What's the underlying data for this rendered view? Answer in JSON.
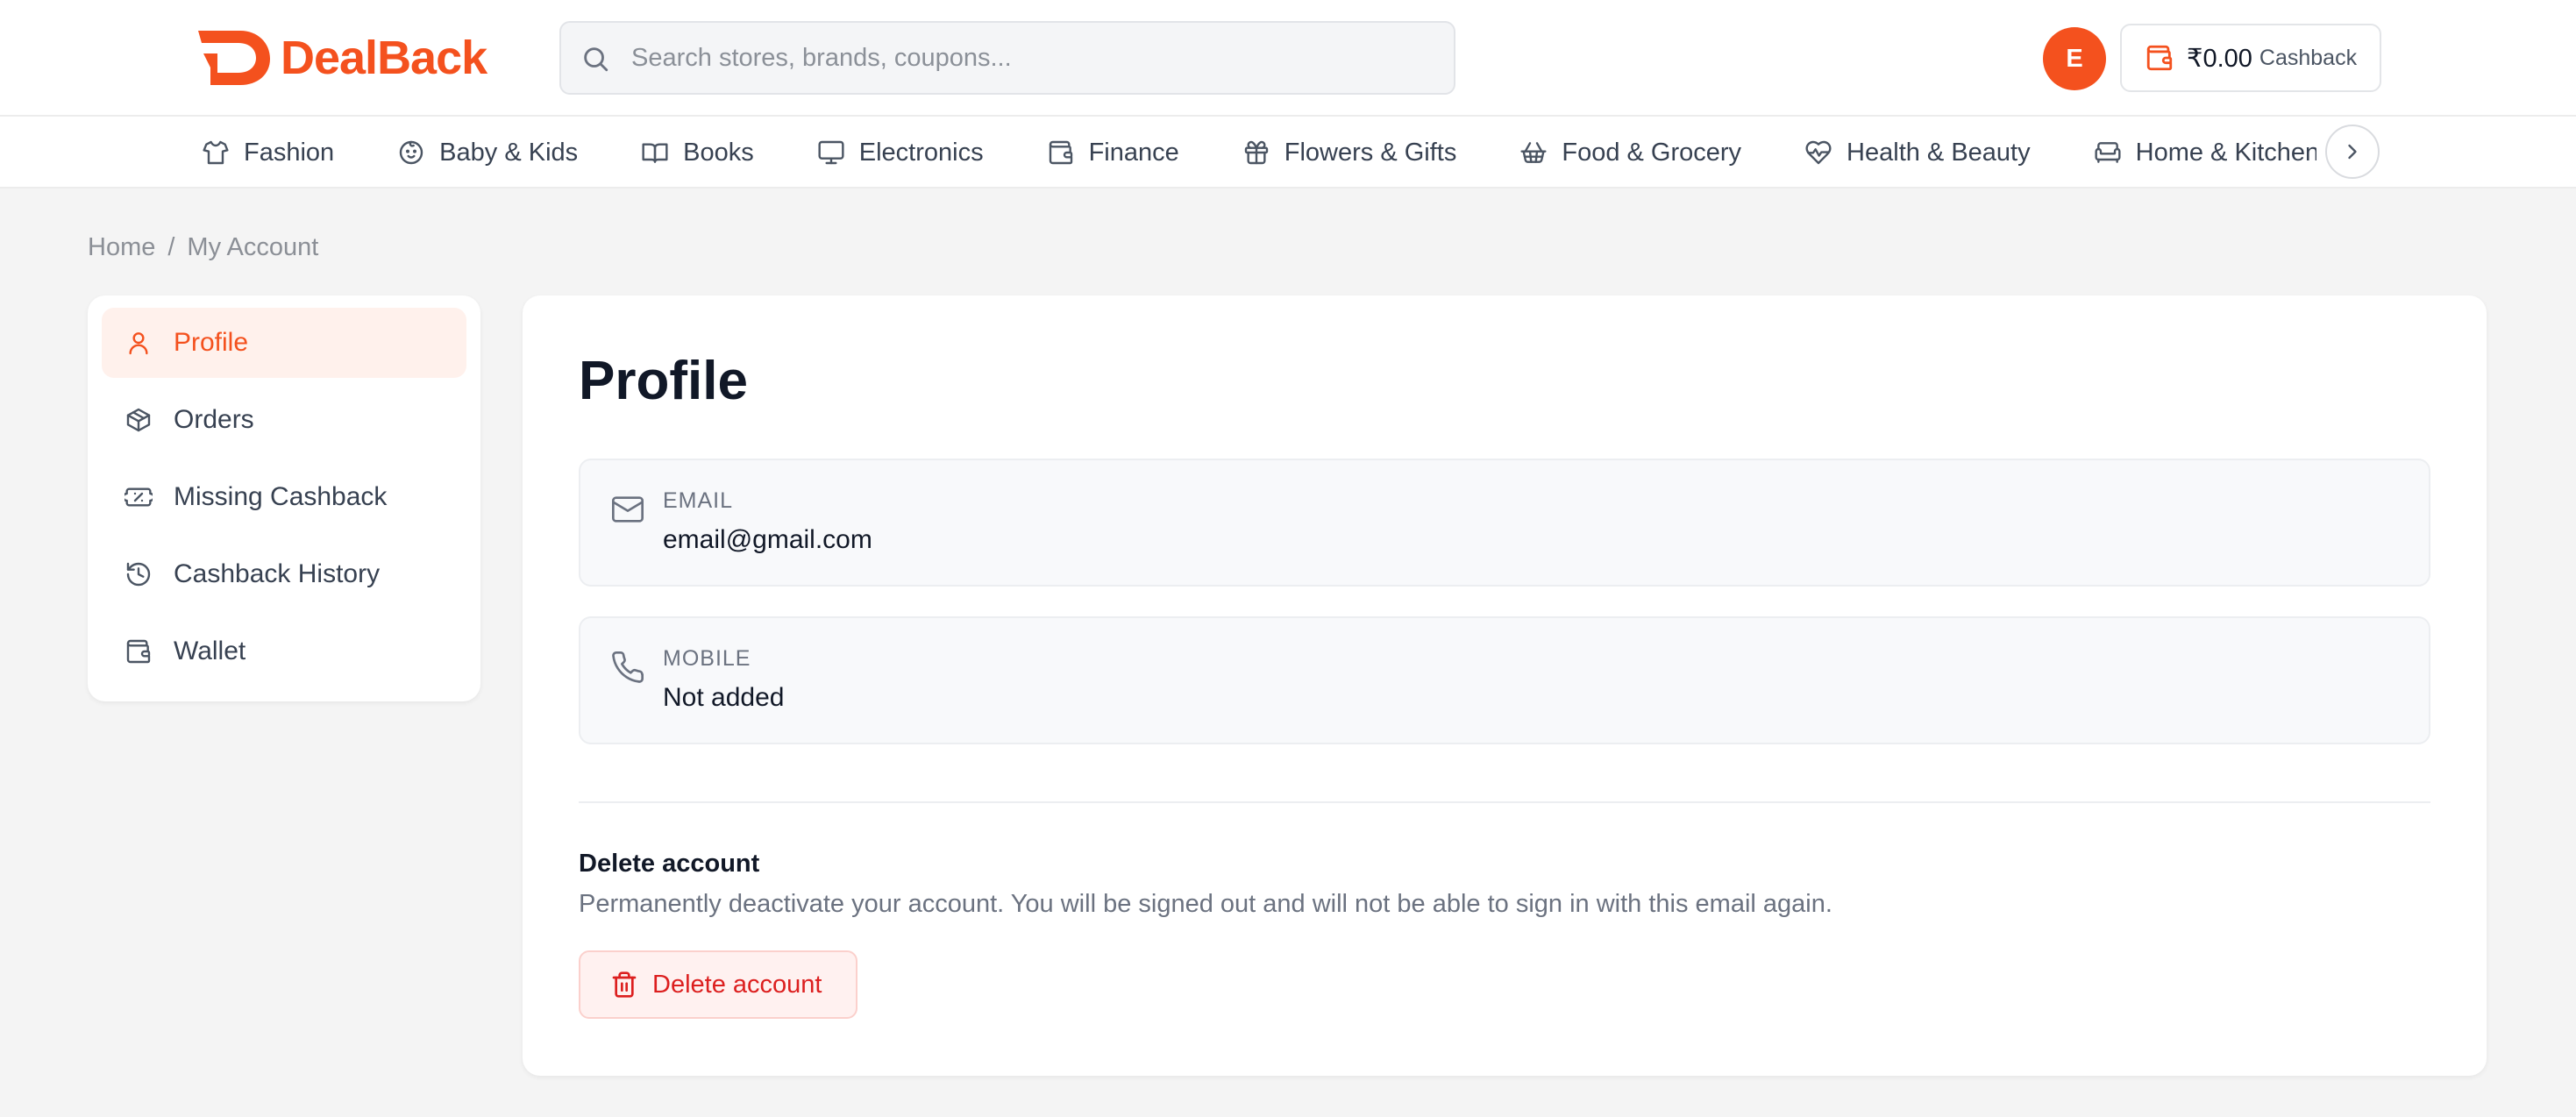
{
  "header": {
    "brand": "DealBack",
    "brand_color": "#f4511e",
    "search_placeholder": "Search stores, brands, coupons...",
    "search_value": "",
    "avatar_initial": "E",
    "cashback_amount": "₹0.00",
    "cashback_label": "Cashback"
  },
  "categories": [
    {
      "label": "Fashion",
      "icon": "shirt-icon"
    },
    {
      "label": "Baby & Kids",
      "icon": "baby-icon"
    },
    {
      "label": "Books",
      "icon": "book-icon"
    },
    {
      "label": "Electronics",
      "icon": "monitor-icon"
    },
    {
      "label": "Finance",
      "icon": "wallet-icon"
    },
    {
      "label": "Flowers & Gifts",
      "icon": "gift-icon"
    },
    {
      "label": "Food & Grocery",
      "icon": "basket-icon"
    },
    {
      "label": "Health & Beauty",
      "icon": "heart-pulse-icon"
    },
    {
      "label": "Home & Kitchen",
      "icon": "sofa-icon"
    }
  ],
  "breadcrumb": {
    "home": "Home",
    "separator": "/",
    "current": "My Account"
  },
  "sidebar": {
    "items": [
      {
        "label": "Profile",
        "icon": "user-icon",
        "active": true
      },
      {
        "label": "Orders",
        "icon": "package-icon",
        "active": false
      },
      {
        "label": "Missing Cashback",
        "icon": "ticket-icon",
        "active": false
      },
      {
        "label": "Cashback History",
        "icon": "history-icon",
        "active": false
      },
      {
        "label": "Wallet",
        "icon": "wallet-icon",
        "active": false
      }
    ]
  },
  "profile": {
    "title": "Profile",
    "email_label": "Email",
    "email_value": "email@gmail.com",
    "mobile_label": "Mobile",
    "mobile_value": "Not added",
    "delete_title": "Delete account",
    "delete_description": "Permanently deactivate your account. You will be signed out and will not be able to sign in with this email again.",
    "delete_button": "Delete account",
    "danger_color": "#dc1f1f"
  }
}
